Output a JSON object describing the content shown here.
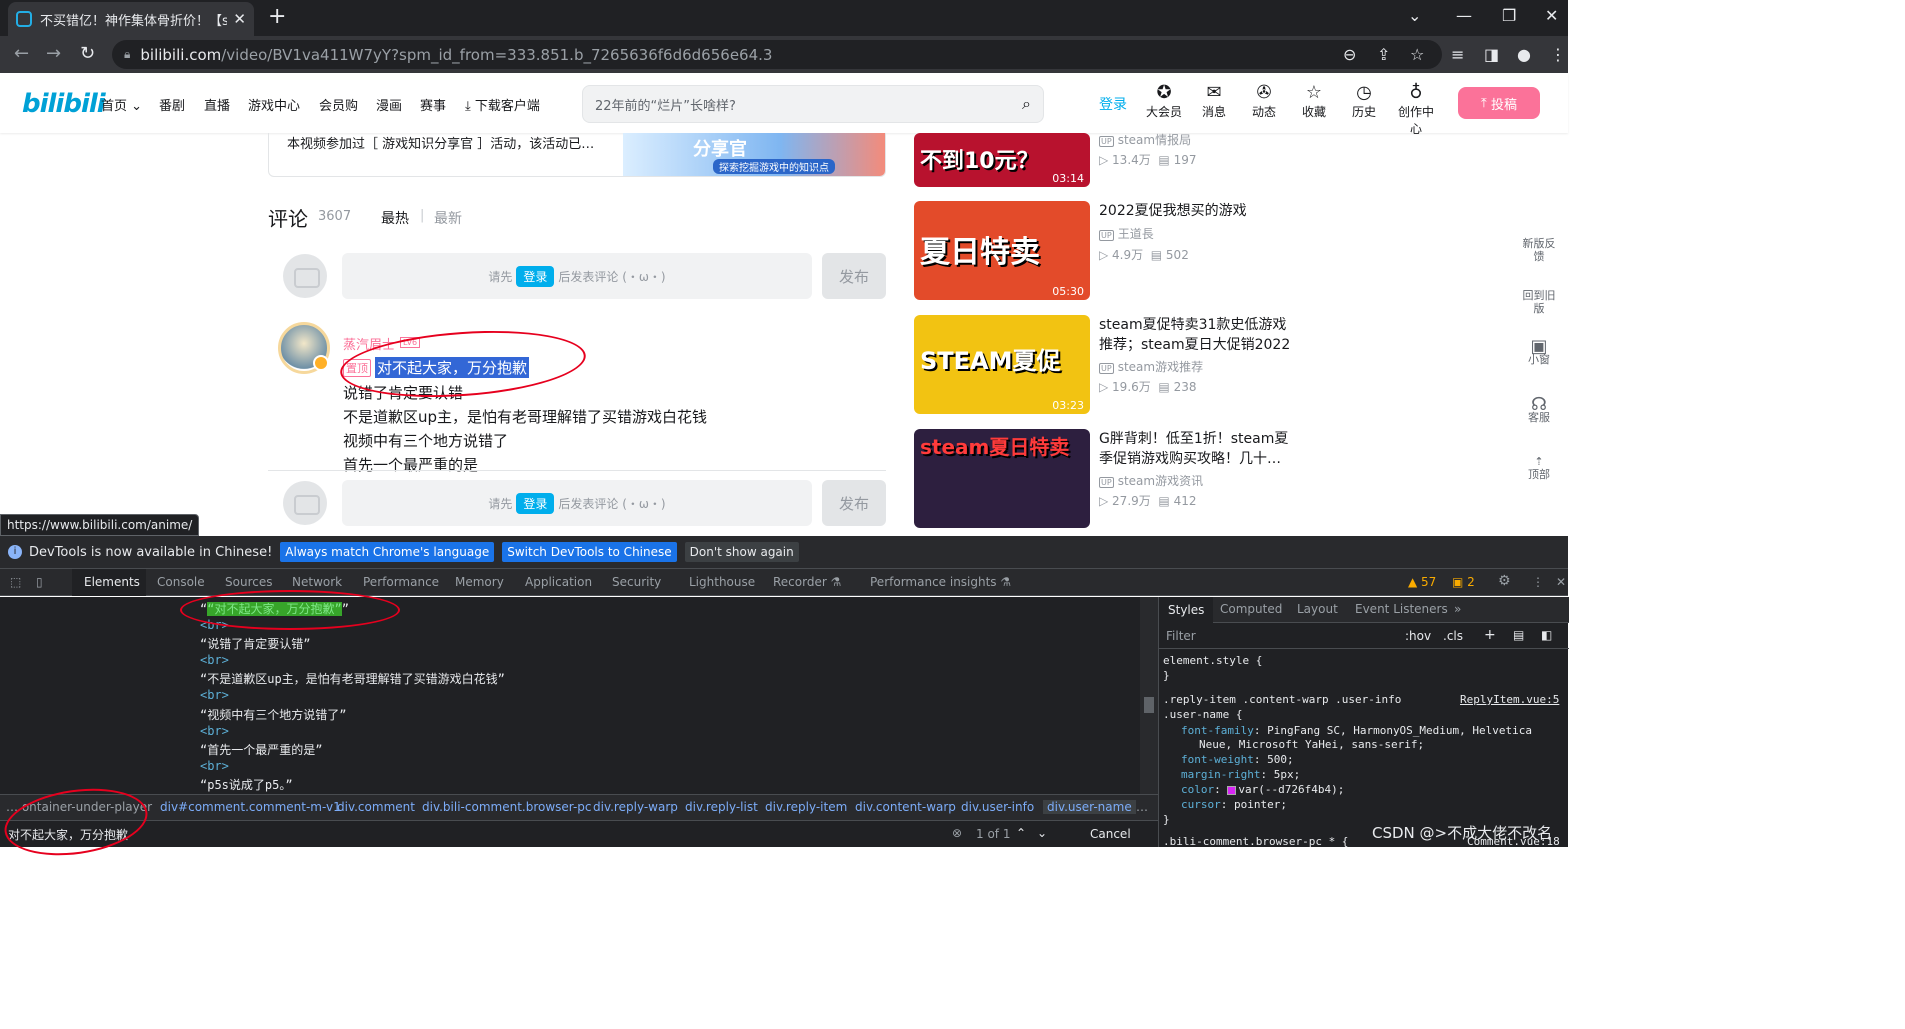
{
  "browser": {
    "tab_title": "不买错亿！神作集体骨折价！【s",
    "url_host": "bilibili.com",
    "url_path": "/video/BV1va411W7yY?spm_id_from=333.851.b_7265636f6d6d656e64.3"
  },
  "header": {
    "logo": "bilibili",
    "nav": [
      "首页",
      "番剧",
      "直播",
      "游戏中心",
      "会员购",
      "漫画",
      "赛事",
      "下载客户端"
    ],
    "search_placeholder": "22年前的“烂片”长啥样?",
    "login": "登录",
    "icons": [
      {
        "label": "大会员",
        "glyph": "✪"
      },
      {
        "label": "消息",
        "glyph": "✉"
      },
      {
        "label": "动态",
        "glyph": "✇"
      },
      {
        "label": "收藏",
        "glyph": "☆"
      },
      {
        "label": "历史",
        "glyph": "◷"
      },
      {
        "label": "创作中心",
        "glyph": "♁"
      }
    ],
    "upload": "投稿"
  },
  "banner": {
    "text": "本视频参加过［ 游戏知识分享官 ］活动，该活动已…",
    "img_title": "分享官",
    "img_sub": "探索挖掘游戏中的知识点"
  },
  "comments": {
    "title": "评论",
    "count": "3607",
    "sort_hot": "最热",
    "sort_new": "最新",
    "box_prefix": "请先",
    "box_login": "登录",
    "box_suffix": "后发表评论 (・ω・)",
    "publish": "发布",
    "user_name": "蒸汽眉士",
    "user_level": "LV6",
    "pinned": "置顶",
    "highlight": "对不起大家，万分抱歉",
    "lines": [
      "说错了肯定要认错",
      "不是道歉区up主，是怕有老哥理解错了买错游戏白花钱",
      "视频中有三个地方说错了",
      "首先一个最严重的是"
    ]
  },
  "videos": [
    {
      "thumb_text": "不到10元？",
      "duration": "03:14",
      "title": "",
      "up": "steam情报局",
      "views": "13.4万",
      "danmaku": "197",
      "bg": "#b8122e"
    },
    {
      "thumb_text": "夏日特卖",
      "duration": "05:30",
      "title": "2022夏促我想买的游戏",
      "up": "王道長",
      "views": "4.9万",
      "danmaku": "502",
      "bg": "#e34b2a"
    },
    {
      "thumb_text": "STEAM夏促",
      "duration": "03:23",
      "title": "steam夏促特卖31款史低游戏推荐；steam夏日大促销2022",
      "up": "steam游戏推荐",
      "views": "19.6万",
      "danmaku": "238",
      "bg": "#f2c312"
    },
    {
      "thumb_text": "steam夏日特卖",
      "duration": "",
      "title": "G胖背刺！低至1折！steam夏季促销游戏购买攻略！几十…",
      "up": "steam游戏资讯",
      "views": "27.9万",
      "danmaku": "412",
      "bg": "#2d1f3f"
    }
  ],
  "side": [
    "新版反馈",
    "回到旧版",
    "小窗",
    "客服",
    "顶部"
  ],
  "status_url": "https://www.bilibili.com/anime/",
  "devtools": {
    "notice": "DevTools is now available in Chinese!",
    "btn_match": "Always match Chrome's language",
    "btn_switch": "Switch DevTools to Chinese",
    "btn_dismiss": "Don't show again",
    "tabs": [
      "Elements",
      "Console",
      "Sources",
      "Network",
      "Performance",
      "Memory",
      "Application",
      "Security",
      "Lighthouse",
      "Recorder ⚗",
      "Performance insights ⚗"
    ],
    "warn_count": "57",
    "issue_count": "2",
    "dom": [
      "“对不起大家，万分抱歉”",
      "<br>",
      "“说错了肯定要认错”",
      "<br>",
      "“不是道歉区up主，是怕有老哥理解错了买错游戏白花钱”",
      "<br>",
      "“视频中有三个地方说错了”",
      "<br>",
      "“首先一个最严重的是”",
      "<br>",
      "“p5s说成了p5。”"
    ],
    "breadcrumbs": [
      "… ontainer-under-player",
      "div#comment.comment-m-v1",
      "div.comment",
      "div.bili-comment.browser-pc",
      "div.reply-warp",
      "div.reply-list",
      "div.reply-item",
      "div.content-warp",
      "div.user-info",
      "div.user-name",
      "…"
    ],
    "find_value": "对不起大家，万分抱歉",
    "find_count": "1 of 1",
    "cancel": "Cancel",
    "style_tabs": [
      "Styles",
      "Computed",
      "Layout",
      "Event Listeners",
      "»"
    ],
    "filter": "Filter",
    "hov": ":hov",
    ".cls": ".cls",
    "css": {
      "element_style": "element.style {",
      "close": "}",
      "selector1": ".reply-item .content-warp .user-info",
      "selector2": ".user-name {",
      "source": "ReplyItem.vue:5",
      "p1": "font-family",
      "v1": "PingFang SC, HarmonyOS_Medium, Helvetica",
      "v1b": "Neue, Microsoft YaHei, sans-serif;",
      "p2": "font-weight",
      "v2": "500;",
      "p3": "margin-right",
      "v3": "5px;",
      "p4": "color",
      "v4": "var(--d726f4b4);",
      "p5": "cursor",
      "v5": "pointer;",
      "next": ".bili-comment.browser-pc * {",
      "next_src": "Comment.vue:18"
    }
  },
  "watermark": "CSDN @>不成大佬不改名"
}
